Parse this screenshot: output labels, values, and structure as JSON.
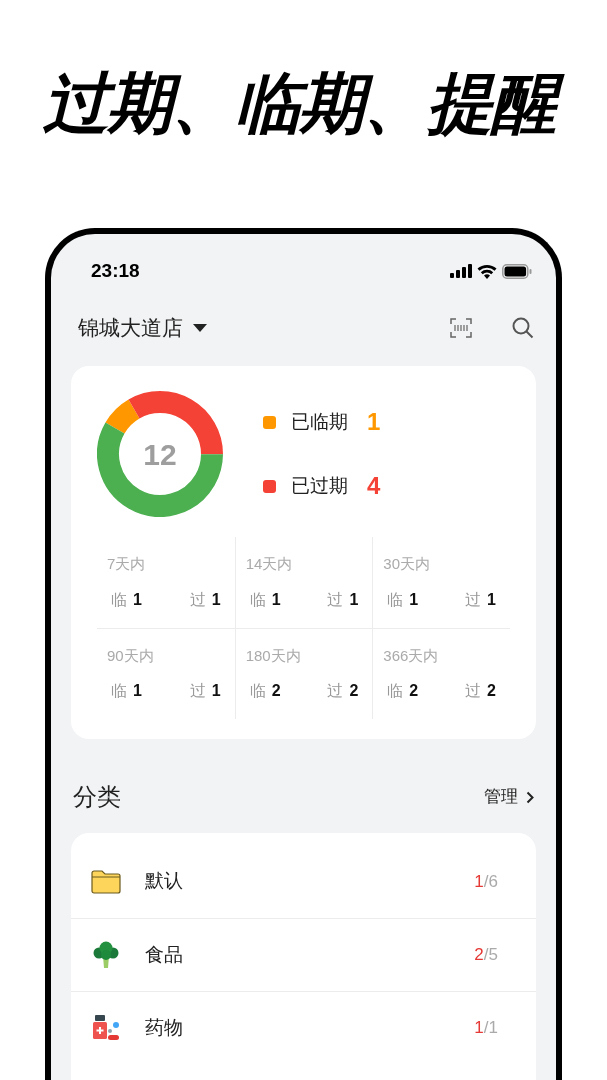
{
  "headline": "过期、临期、提醒",
  "status_bar": {
    "time": "23:18"
  },
  "header": {
    "store": "锦城大道店"
  },
  "summary": {
    "total": "12",
    "legend": [
      {
        "label": "已临期",
        "value": "1",
        "color": "#ff9800"
      },
      {
        "label": "已过期",
        "value": "4",
        "color": "#f44336"
      }
    ],
    "periods": [
      {
        "label": "7天内",
        "near_label": "临",
        "near": "1",
        "expired_label": "过",
        "expired": "1"
      },
      {
        "label": "14天内",
        "near_label": "临",
        "near": "1",
        "expired_label": "过",
        "expired": "1"
      },
      {
        "label": "30天内",
        "near_label": "临",
        "near": "1",
        "expired_label": "过",
        "expired": "1"
      },
      {
        "label": "90天内",
        "near_label": "临",
        "near": "1",
        "expired_label": "过",
        "expired": "1"
      },
      {
        "label": "180天内",
        "near_label": "临",
        "near": "2",
        "expired_label": "过",
        "expired": "2"
      },
      {
        "label": "366天内",
        "near_label": "临",
        "near": "2",
        "expired_label": "过",
        "expired": "2"
      }
    ]
  },
  "categories": {
    "title": "分类",
    "manage": "管理",
    "items": [
      {
        "kind": "folder",
        "name": "默认",
        "alert": "1",
        "rest": "/6"
      },
      {
        "kind": "food",
        "name": "食品",
        "alert": "2",
        "rest": "/5"
      },
      {
        "kind": "medicine",
        "name": "药物",
        "alert": "1",
        "rest": "/1"
      }
    ]
  }
}
